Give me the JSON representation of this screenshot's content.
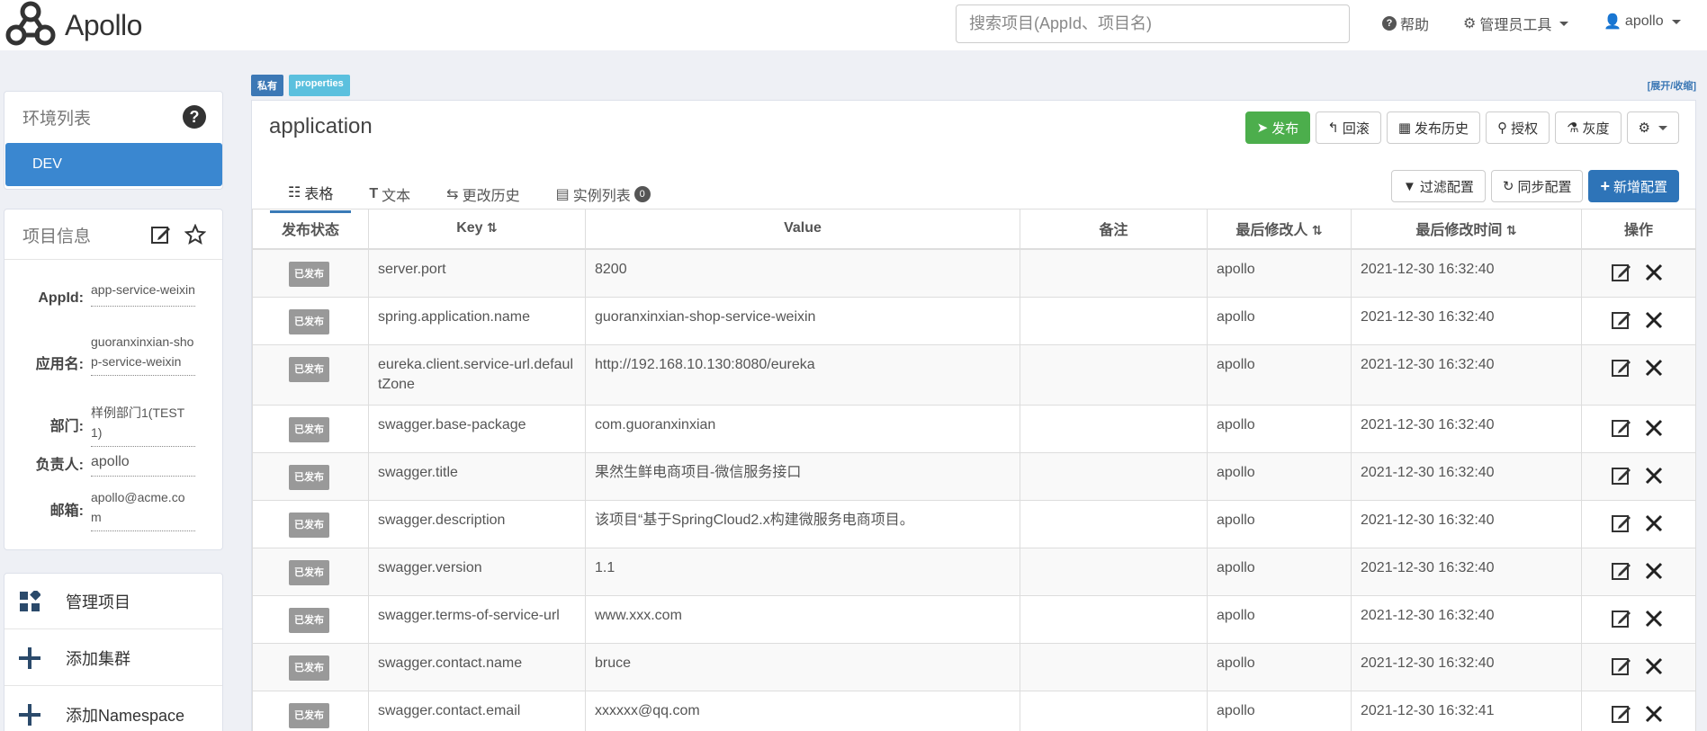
{
  "app": {
    "logo_text": "Apollo"
  },
  "search": {
    "placeholder": "搜索项目(AppId、项目名)"
  },
  "nav": {
    "help": "帮助",
    "admin_tools": "管理员工具",
    "user": "apollo"
  },
  "env_panel": {
    "title": "环境列表",
    "env": "DEV"
  },
  "info_panel": {
    "title": "项目信息",
    "rows": [
      {
        "label": "AppId:",
        "value": "app-service-weixin"
      },
      {
        "label": "应用名:",
        "value": "guoranxinxian-shop-service-weixin"
      },
      {
        "label": "部门:",
        "value": "样例部门1(TEST1)"
      },
      {
        "label": "负责人:",
        "value": "apollo"
      },
      {
        "label": "邮箱:",
        "value": "apollo@acme.com"
      }
    ]
  },
  "menu": [
    {
      "label": "管理项目",
      "icon": "grid-icon"
    },
    {
      "label": "添加集群",
      "icon": "plus-icon"
    },
    {
      "label": "添加Namespace",
      "icon": "plus-icon"
    }
  ],
  "namespace": {
    "badge_private": "私有",
    "badge_format": "properties",
    "expand_toggle": "[展开/收缩]",
    "name": "application",
    "buttons": {
      "publish": "发布",
      "rollback": "回滚",
      "history": "发布历史",
      "grant": "授权",
      "gray": "灰度"
    },
    "tabs": {
      "table": "表格",
      "text": "文本",
      "change_history": "更改历史",
      "instances": "实例列表",
      "instances_count": "0"
    },
    "tab_buttons": {
      "filter": "过滤配置",
      "sync": "同步配置",
      "add": "新增配置"
    },
    "columns": {
      "status": "发布状态",
      "key": "Key",
      "value": "Value",
      "comment": "备注",
      "modifier": "最后修改人",
      "modified_time": "最后修改时间",
      "ops": "操作"
    }
  },
  "rows": [
    {
      "status": "已发布",
      "key": "server.port",
      "value": "8200",
      "comment": "",
      "modifier": "apollo",
      "time": "2021-12-30 16:32:40"
    },
    {
      "status": "已发布",
      "key": "spring.application.name",
      "value": "guoranxinxian-shop-service-weixin",
      "comment": "",
      "modifier": "apollo",
      "time": "2021-12-30 16:32:40"
    },
    {
      "status": "已发布",
      "key": "eureka.client.service-url.defaultZone",
      "value": "http://192.168.10.130:8080/eureka",
      "comment": "",
      "modifier": "apollo",
      "time": "2021-12-30 16:32:40"
    },
    {
      "status": "已发布",
      "key": "swagger.base-package",
      "value": "com.guoranxinxian",
      "comment": "",
      "modifier": "apollo",
      "time": "2021-12-30 16:32:40"
    },
    {
      "status": "已发布",
      "key": "swagger.title",
      "value": "果然生鲜电商项目-微信服务接口",
      "comment": "",
      "modifier": "apollo",
      "time": "2021-12-30 16:32:40"
    },
    {
      "status": "已发布",
      "key": "swagger.description",
      "value": "该项目“基于SpringCloud2.x构建微服务电商项目。",
      "comment": "",
      "modifier": "apollo",
      "time": "2021-12-30 16:32:40"
    },
    {
      "status": "已发布",
      "key": "swagger.version",
      "value": "1.1",
      "comment": "",
      "modifier": "apollo",
      "time": "2021-12-30 16:32:40"
    },
    {
      "status": "已发布",
      "key": "swagger.terms-of-service-url",
      "value": "www.xxx.com",
      "comment": "",
      "modifier": "apollo",
      "time": "2021-12-30 16:32:40"
    },
    {
      "status": "已发布",
      "key": "swagger.contact.name",
      "value": "bruce",
      "comment": "",
      "modifier": "apollo",
      "time": "2021-12-30 16:32:40"
    },
    {
      "status": "已发布",
      "key": "swagger.contact.email",
      "value": "xxxxxx@qq.com",
      "comment": "",
      "modifier": "apollo",
      "time": "2021-12-30 16:32:41"
    }
  ]
}
